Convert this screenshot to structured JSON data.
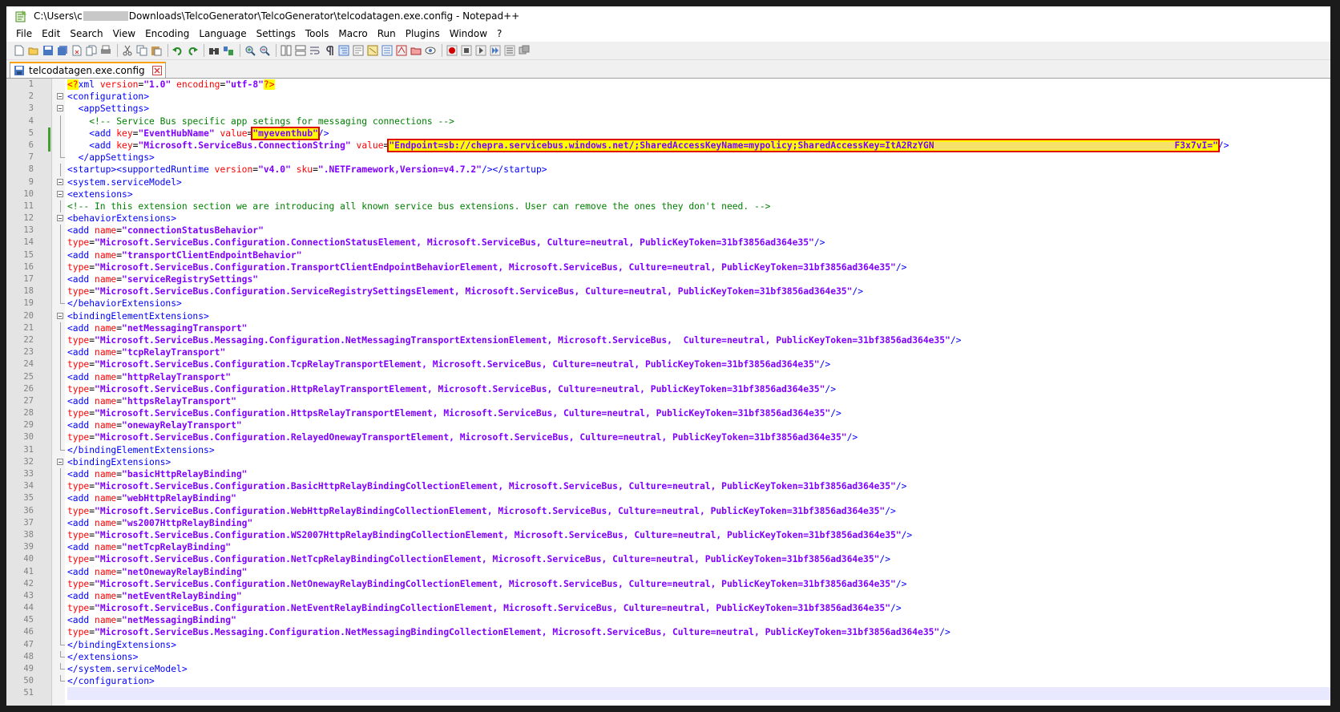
{
  "window": {
    "title_prefix": "C:\\Users\\c",
    "title_suffix": "Downloads\\TelcoGenerator\\TelcoGenerator\\telcodatagen.exe.config - Notepad++"
  },
  "menu": [
    "File",
    "Edit",
    "Search",
    "View",
    "Encoding",
    "Language",
    "Settings",
    "Tools",
    "Macro",
    "Run",
    "Plugins",
    "Window",
    "?"
  ],
  "tab": {
    "label": "telcodatagen.exe.config"
  },
  "colors": {
    "accent_tab": "#f7a200",
    "highlight": "#ffff00",
    "highlight_border": "#e00000"
  },
  "icons": [
    "new-icon",
    "open-icon",
    "save-icon",
    "save-all-icon",
    "close-icon",
    "close-all-icon",
    "print-icon",
    "cut-icon",
    "copy-icon",
    "paste-icon",
    "undo-icon",
    "redo-icon",
    "find-icon",
    "replace-icon",
    "zoom-in-icon",
    "zoom-out-icon",
    "sync-v-icon",
    "sync-h-icon",
    "wrap-icon",
    "all-chars-icon",
    "indent-guide-icon",
    "udl-icon",
    "doc-map-icon",
    "func-list-icon",
    "folder-workspace-icon",
    "monitor-icon",
    "record-icon",
    "stop-icon",
    "play-icon",
    "play-multi-icon",
    "save-macro-icon"
  ],
  "code": {
    "l1": {
      "ver_attr": "version",
      "ver_val": "\"1.0\"",
      "enc_attr": "encoding",
      "enc_val": "\"utf-8\""
    },
    "l2": "<configuration>",
    "l3": "<appSettings>",
    "l4": "<!-- Service Bus specific app setings for messaging connections -->",
    "l5": {
      "key": "\"EventHubName\"",
      "value": "\"myeventhub\""
    },
    "l6": {
      "key": "\"Microsoft.ServiceBus.ConnectionString\"",
      "value_start": "\"Endpoint=sb://chepra.servicebus.windows.net/;SharedAccessKeyName=mypolicy;SharedAccessKey=ItA2RzYGN",
      "value_end": "F3x7vI=\""
    },
    "l7": "</appSettings>",
    "l8": {
      "runtime": "\"v4.0\"",
      "sku": "\".NETFramework,Version=v4.7.2\""
    },
    "l9": "<system.serviceModel>",
    "l10": "<extensions>",
    "l11": "<!-- In this extension section we are introducing all known service bus extensions. User can remove the ones they don't need. -->",
    "l12": "<behaviorExtensions>",
    "l13": "\"connectionStatusBehavior\"",
    "l14": "\"Microsoft.ServiceBus.Configuration.ConnectionStatusElement, Microsoft.ServiceBus, Culture=neutral, PublicKeyToken=31bf3856ad364e35\"",
    "l15": "\"transportClientEndpointBehavior\"",
    "l16": "\"Microsoft.ServiceBus.Configuration.TransportClientEndpointBehaviorElement, Microsoft.ServiceBus, Culture=neutral, PublicKeyToken=31bf3856ad364e35\"",
    "l17": "\"serviceRegistrySettings\"",
    "l18": "\"Microsoft.ServiceBus.Configuration.ServiceRegistrySettingsElement, Microsoft.ServiceBus, Culture=neutral, PublicKeyToken=31bf3856ad364e35\"",
    "l19": "</behaviorExtensions>",
    "l20": "<bindingElementExtensions>",
    "l21": "\"netMessagingTransport\"",
    "l22": "\"Microsoft.ServiceBus.Messaging.Configuration.NetMessagingTransportExtensionElement, Microsoft.ServiceBus,  Culture=neutral, PublicKeyToken=31bf3856ad364e35\"",
    "l23": "\"tcpRelayTransport\"",
    "l24": "\"Microsoft.ServiceBus.Configuration.TcpRelayTransportElement, Microsoft.ServiceBus, Culture=neutral, PublicKeyToken=31bf3856ad364e35\"",
    "l25": "\"httpRelayTransport\"",
    "l26": "\"Microsoft.ServiceBus.Configuration.HttpRelayTransportElement, Microsoft.ServiceBus, Culture=neutral, PublicKeyToken=31bf3856ad364e35\"",
    "l27": "\"httpsRelayTransport\"",
    "l28": "\"Microsoft.ServiceBus.Configuration.HttpsRelayTransportElement, Microsoft.ServiceBus, Culture=neutral, PublicKeyToken=31bf3856ad364e35\"",
    "l29": "\"onewayRelayTransport\"",
    "l30": "\"Microsoft.ServiceBus.Configuration.RelayedOnewayTransportElement, Microsoft.ServiceBus, Culture=neutral, PublicKeyToken=31bf3856ad364e35\"",
    "l31": "</bindingElementExtensions>",
    "l32": "<bindingExtensions>",
    "l33": "\"basicHttpRelayBinding\"",
    "l34": "\"Microsoft.ServiceBus.Configuration.BasicHttpRelayBindingCollectionElement, Microsoft.ServiceBus, Culture=neutral, PublicKeyToken=31bf3856ad364e35\"",
    "l35": "\"webHttpRelayBinding\"",
    "l36": "\"Microsoft.ServiceBus.Configuration.WebHttpRelayBindingCollectionElement, Microsoft.ServiceBus, Culture=neutral, PublicKeyToken=31bf3856ad364e35\"",
    "l37": "\"ws2007HttpRelayBinding\"",
    "l38": "\"Microsoft.ServiceBus.Configuration.WS2007HttpRelayBindingCollectionElement, Microsoft.ServiceBus, Culture=neutral, PublicKeyToken=31bf3856ad364e35\"",
    "l39": "\"netTcpRelayBinding\"",
    "l40": "\"Microsoft.ServiceBus.Configuration.NetTcpRelayBindingCollectionElement, Microsoft.ServiceBus, Culture=neutral, PublicKeyToken=31bf3856ad364e35\"",
    "l41": "\"netOnewayRelayBinding\"",
    "l42": "\"Microsoft.ServiceBus.Configuration.NetOnewayRelayBindingCollectionElement, Microsoft.ServiceBus, Culture=neutral, PublicKeyToken=31bf3856ad364e35\"",
    "l43": "\"netEventRelayBinding\"",
    "l44": "\"Microsoft.ServiceBus.Configuration.NetEventRelayBindingCollectionElement, Microsoft.ServiceBus, Culture=neutral, PublicKeyToken=31bf3856ad364e35\"",
    "l45": "\"netMessagingBinding\"",
    "l46": "\"Microsoft.ServiceBus.Messaging.Configuration.NetMessagingBindingCollectionElement, Microsoft.ServiceBus, Culture=neutral, PublicKeyToken=31bf3856ad364e35\"",
    "l47": "</bindingExtensions>",
    "l48": "</extensions>",
    "l49": "</system.serviceModel>",
    "l50": "</configuration>"
  }
}
